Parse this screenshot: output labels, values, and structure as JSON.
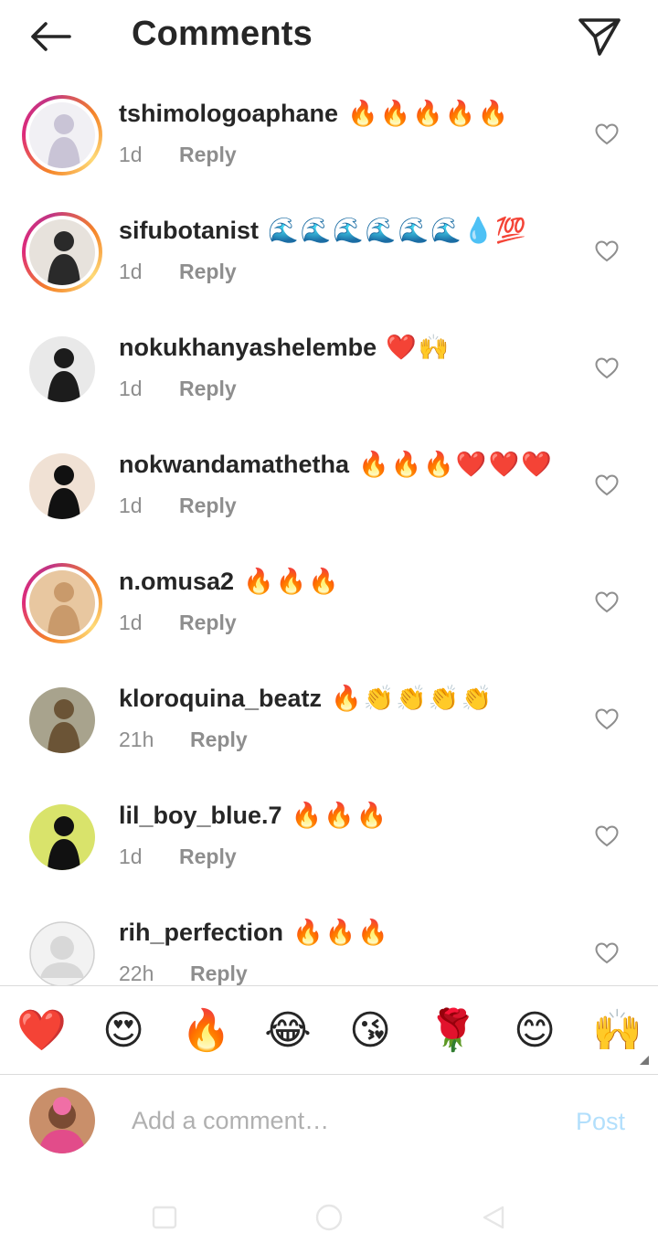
{
  "header": {
    "title": "Comments",
    "back_icon": "arrow-left-icon",
    "share_icon": "paper-plane-icon"
  },
  "comments": [
    {
      "username": "tshimologoaphane",
      "emojis": "🔥🔥🔥🔥🔥",
      "time": "1d",
      "reply": "Reply",
      "story_ring": true,
      "avatar_colors": [
        "#c9c4d6",
        "#f1f0f4"
      ]
    },
    {
      "username": "sifubotanist",
      "emojis": "🌊🌊🌊🌊🌊🌊💧💯",
      "time": "1d",
      "reply": "Reply",
      "story_ring": true,
      "avatar_colors": [
        "#2a2a2a",
        "#e7e2dc"
      ]
    },
    {
      "username": "nokukhanyashelembe",
      "emojis": "❤️🙌",
      "time": "1d",
      "reply": "Reply",
      "story_ring": false,
      "avatar_colors": [
        "#1c1c1c",
        "#e9e9e9"
      ]
    },
    {
      "username": "nokwandamathetha",
      "emojis": "🔥🔥🔥❤️❤️❤️",
      "time": "1d",
      "reply": "Reply",
      "story_ring": false,
      "avatar_colors": [
        "#111111",
        "#f0e1d4"
      ]
    },
    {
      "username": "n.omusa2",
      "emojis": "🔥🔥🔥",
      "time": "1d",
      "reply": "Reply",
      "story_ring": true,
      "avatar_colors": [
        "#c99a6b",
        "#e8c7a0"
      ]
    },
    {
      "username": "kloroquina_beatz",
      "emojis": "🔥👏👏👏👏",
      "time": "21h",
      "reply": "Reply",
      "story_ring": false,
      "avatar_colors": [
        "#6b5436",
        "#a8a38d"
      ]
    },
    {
      "username": "lil_boy_blue.7",
      "emojis": "🔥🔥🔥",
      "time": "1d",
      "reply": "Reply",
      "story_ring": false,
      "avatar_colors": [
        "#111111",
        "#d9e36b"
      ]
    },
    {
      "username": "rih_perfection",
      "emojis": "🔥🔥🔥",
      "time": "22h",
      "reply": "Reply",
      "story_ring": false,
      "avatar_colors": [
        "#e6e6e6",
        "#ffffff"
      ]
    }
  ],
  "like_icon": "heart-outline-icon",
  "emoji_bar": [
    "❤️",
    "😍",
    "🔥",
    "😂",
    "😘",
    "🌹",
    "😊",
    "🙌"
  ],
  "composer": {
    "placeholder": "Add a comment…",
    "post_label": "Post",
    "post_color": "#b2dffc"
  },
  "navbar": {
    "items": [
      "square-icon",
      "circle-icon",
      "triangle-back-icon"
    ]
  }
}
